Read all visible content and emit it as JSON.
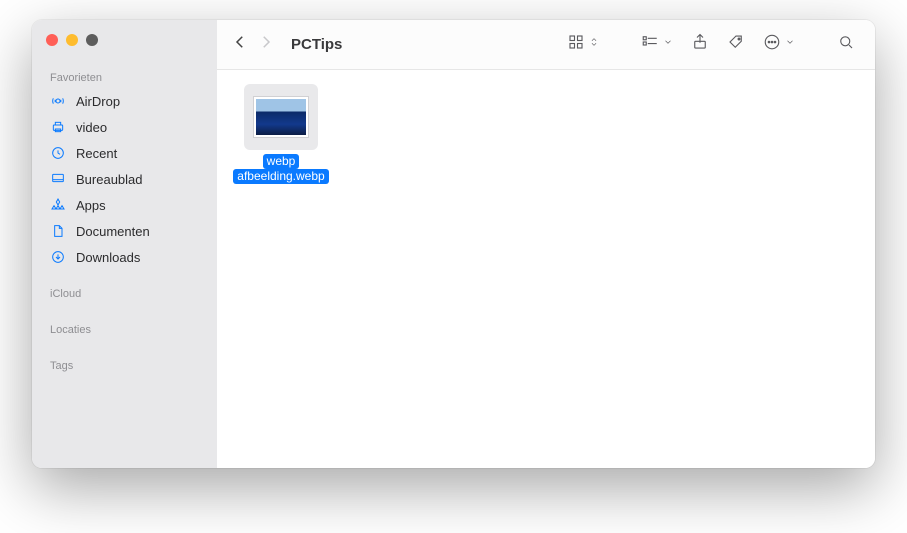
{
  "window": {
    "title": "PCTips"
  },
  "sidebar": {
    "sections": [
      {
        "header": "Favorieten",
        "items": [
          {
            "icon": "airdrop",
            "label": "AirDrop"
          },
          {
            "icon": "printer",
            "label": "video"
          },
          {
            "icon": "clock",
            "label": "Recent"
          },
          {
            "icon": "desktop",
            "label": "Bureaublad"
          },
          {
            "icon": "apps",
            "label": "Apps"
          },
          {
            "icon": "document",
            "label": "Documenten"
          },
          {
            "icon": "download",
            "label": "Downloads"
          }
        ]
      },
      {
        "header": "iCloud",
        "items": []
      },
      {
        "header": "Locaties",
        "items": []
      },
      {
        "header": "Tags",
        "items": []
      }
    ]
  },
  "files": [
    {
      "name_line1": "webp",
      "name_line2": "afbeelding.webp",
      "selected": true
    }
  ]
}
